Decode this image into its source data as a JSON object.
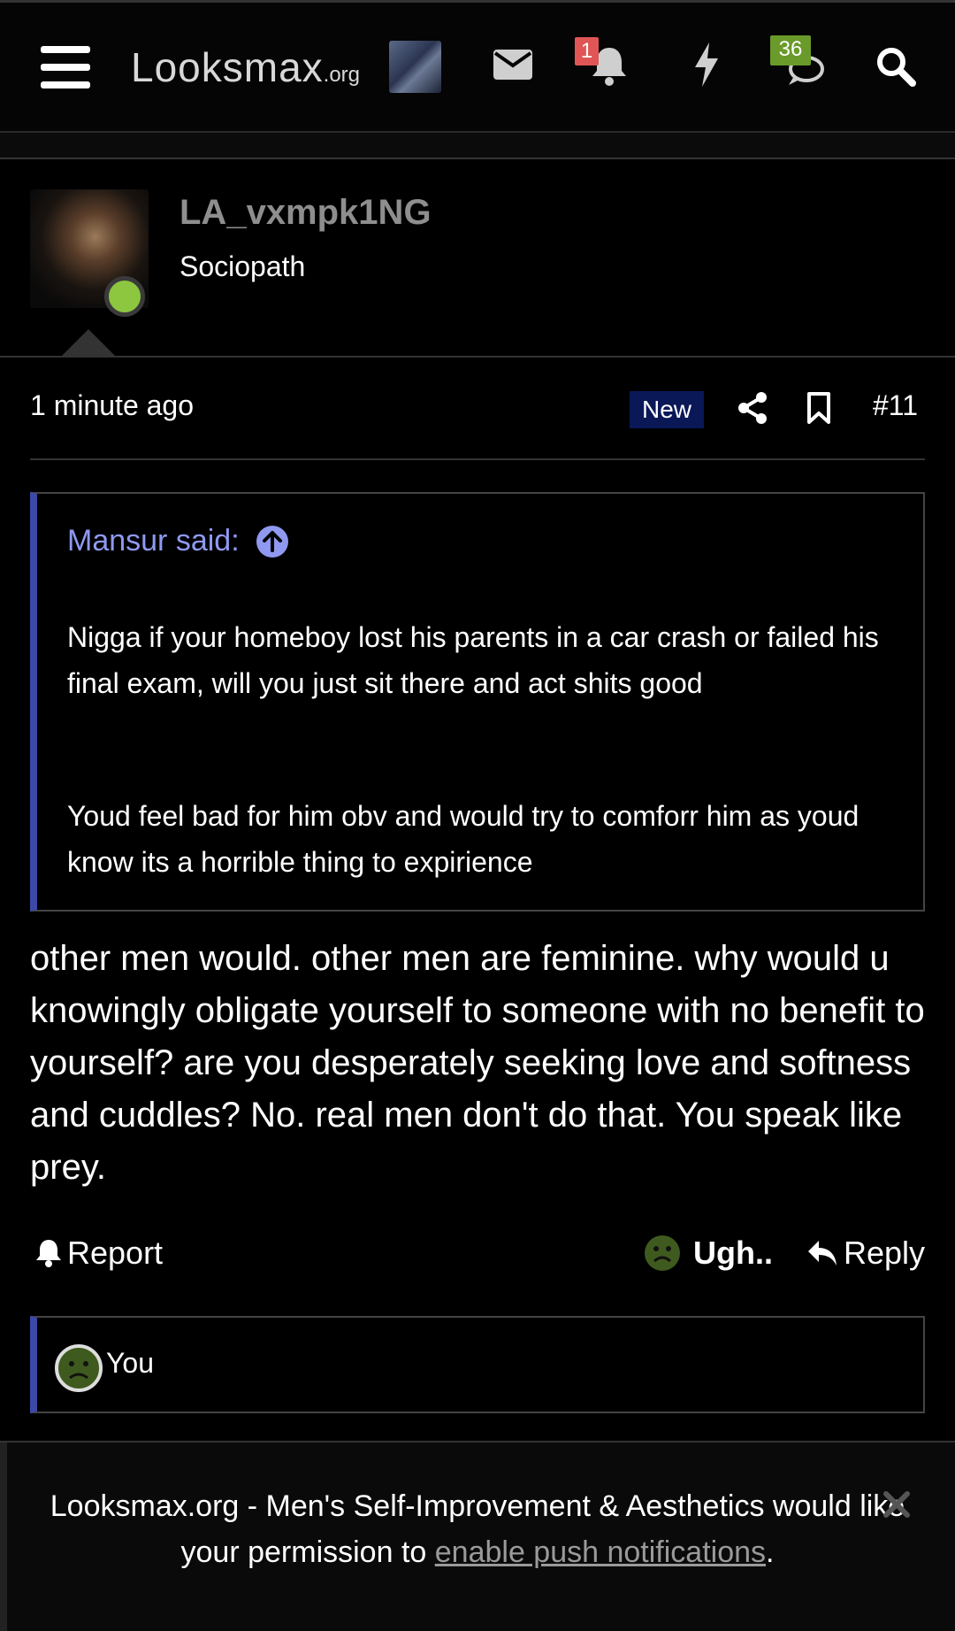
{
  "header": {
    "logo_main": "Looksmax",
    "logo_suffix": ".org",
    "notifications_count": "1",
    "conversations_count": "36",
    "icons": [
      "menu-icon",
      "mail-icon",
      "bell-icon",
      "lightning-icon",
      "chat-icon",
      "search-icon"
    ]
  },
  "post": {
    "username": "LA_vxmpk1NG",
    "user_title": "Sociopath",
    "time": "1 minute ago",
    "new_label": "New",
    "post_number": "#11",
    "quote": {
      "author_label": "Mansur said:",
      "paragraphs": [
        "Nigga if your homeboy lost his parents in a car crash or failed his final exam, will you just sit there and act shits good",
        "Youd feel bad for him obv and would try to comforr him as youd know its a horrible thing to expirience"
      ]
    },
    "message": "other men would. other men are feminine. why would u knowingly obligate yourself to someone with no benefit to yourself? are you desperately seeking love and softness and cuddles? No. real men don't do that. You speak like prey.",
    "actions": {
      "report": "Report",
      "reaction": "Ugh..",
      "reply": "Reply"
    },
    "reaction_list": {
      "by": "You"
    }
  },
  "push_prompt": {
    "text_before": "Looksmax.org - Men's Self-Improvement & Aesthetics would like your permission to ",
    "link": "enable push notifications",
    "text_after": "."
  },
  "colors": {
    "accent_border": "#3c49a7",
    "quote_author": "#8f99f0",
    "online": "#8dc63f",
    "badge_red": "#e05555",
    "badge_green": "#6a9a2a",
    "new_badge_bg": "#0a1858"
  }
}
